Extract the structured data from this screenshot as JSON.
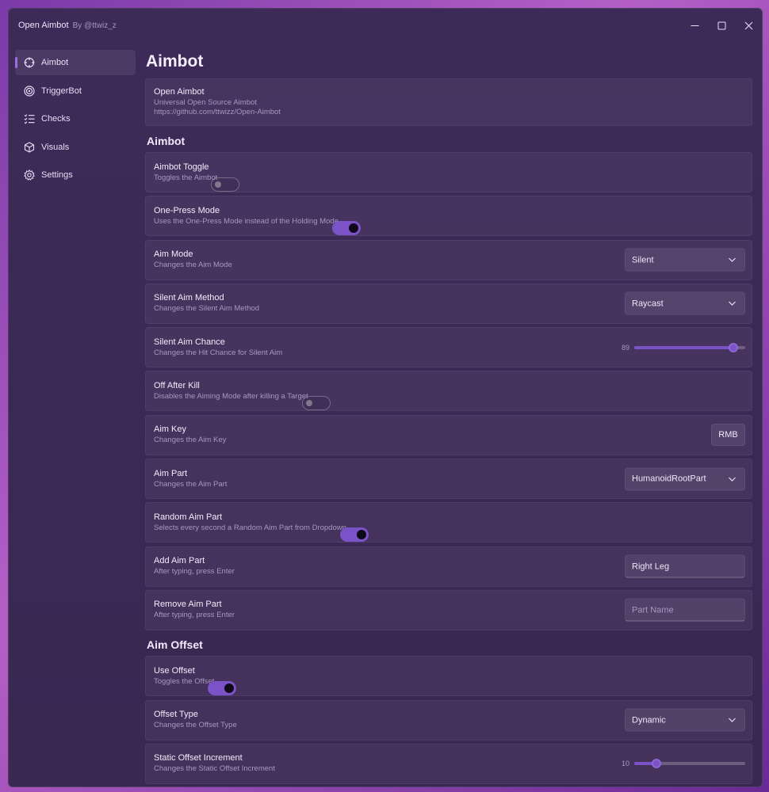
{
  "window": {
    "title": "Open Aimbot",
    "author": "By @ttwiz_z"
  },
  "sidebar": {
    "items": [
      {
        "label": "Aimbot",
        "icon": "crosshair-icon",
        "active": true
      },
      {
        "label": "TriggerBot",
        "icon": "target-icon"
      },
      {
        "label": "Checks",
        "icon": "checklist-icon"
      },
      {
        "label": "Visuals",
        "icon": "cube-icon"
      },
      {
        "label": "Settings",
        "icon": "gear-icon"
      }
    ]
  },
  "page": {
    "title": "Aimbot",
    "info": {
      "title": "Open Aimbot",
      "desc": "Universal Open Source Aimbot",
      "url": "https://github.com/ttwizz/Open-Aimbot"
    },
    "sections": [
      {
        "title": "Aimbot"
      },
      {
        "title": "Aim Offset"
      }
    ],
    "settings": {
      "aimbot_toggle": {
        "title": "Aimbot Toggle",
        "desc": "Toggles the Aimbot",
        "value": false
      },
      "one_press_mode": {
        "title": "One-Press Mode",
        "desc": "Uses the One-Press Mode instead of the Holding Mode",
        "value": true
      },
      "aim_mode": {
        "title": "Aim Mode",
        "desc": "Changes the Aim Mode",
        "value": "Silent"
      },
      "silent_aim_method": {
        "title": "Silent Aim Method",
        "desc": "Changes the Silent Aim Method",
        "value": "Raycast"
      },
      "silent_aim_chance": {
        "title": "Silent Aim Chance",
        "desc": "Changes the Hit Chance for Silent Aim",
        "value": "89",
        "fraction": 0.89
      },
      "off_after_kill": {
        "title": "Off After Kill",
        "desc": "Disables the Aiming Mode after killing a Target",
        "value": false
      },
      "aim_key": {
        "title": "Aim Key",
        "desc": "Changes the Aim Key",
        "value": "RMB"
      },
      "aim_part": {
        "title": "Aim Part",
        "desc": "Changes the Aim Part",
        "value": "HumanoidRootPart"
      },
      "random_aim_part": {
        "title": "Random Aim Part",
        "desc": "Selects every second a Random Aim Part from Dropdown",
        "value": true
      },
      "add_aim_part": {
        "title": "Add Aim Part",
        "desc": "After typing, press Enter",
        "value": "Right Leg",
        "placeholder": ""
      },
      "remove_aim_part": {
        "title": "Remove Aim Part",
        "desc": "After typing, press Enter",
        "value": "",
        "placeholder": "Part Name"
      },
      "use_offset": {
        "title": "Use Offset",
        "desc": "Toggles the Offset",
        "value": true
      },
      "offset_type": {
        "title": "Offset Type",
        "desc": "Changes the Offset Type",
        "value": "Dynamic"
      },
      "static_offset_increment": {
        "title": "Static Offset Increment",
        "desc": "Changes the Static Offset Increment",
        "value": "10",
        "fraction": 0.2
      }
    }
  },
  "colors": {
    "accent": "#7c52c8",
    "window_bg": "#3d2a58",
    "text_secondary": "#a897bf"
  }
}
